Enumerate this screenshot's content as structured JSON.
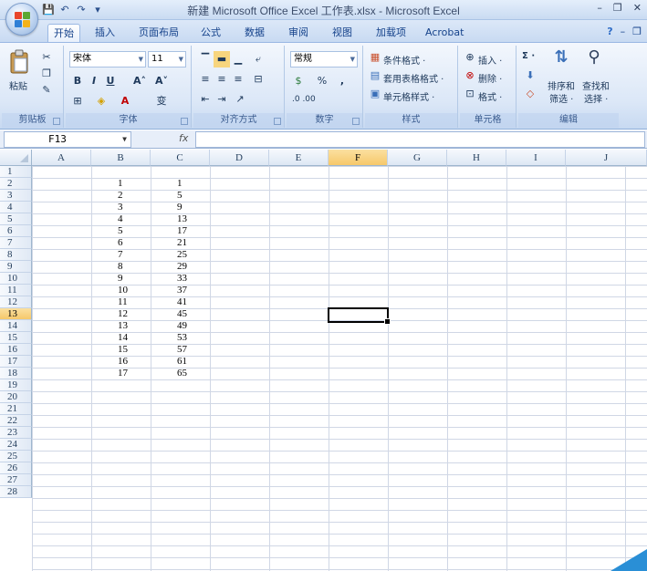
{
  "window": {
    "title": "新建 Microsoft Office Excel 工作表.xlsx - Microsoft Excel",
    "minimize": "–",
    "restore": "❐",
    "close": "✕"
  },
  "qat": {
    "save": "💾",
    "undo": "↶",
    "redo": "↷",
    "more": "▾"
  },
  "tabs": [
    {
      "label": "开始",
      "active": true
    },
    {
      "label": "插入"
    },
    {
      "label": "页面布局"
    },
    {
      "label": "公式"
    },
    {
      "label": "数据"
    },
    {
      "label": "审阅"
    },
    {
      "label": "视图"
    },
    {
      "label": "加载项"
    },
    {
      "label": "Acrobat"
    }
  ],
  "tab_right": {
    "help": "?",
    "min": "–",
    "restore": "❐"
  },
  "ribbon": {
    "clipboard": {
      "label": "剪贴板",
      "paste": "粘贴"
    },
    "font": {
      "label": "字体",
      "name": "宋体",
      "size": "11",
      "bold": "B",
      "italic": "I",
      "underline": "U",
      "grow": "A˄",
      "shrink": "A˅",
      "wen": "变"
    },
    "align": {
      "label": "对齐方式"
    },
    "number": {
      "label": "数字",
      "format": "常规",
      "percent": "%",
      "comma": ",",
      "inc": ".0 .00"
    },
    "styles": {
      "label": "样式",
      "conditional": "条件格式 ·",
      "table": "套用表格格式 ·",
      "cell": "单元格样式 ·"
    },
    "cells": {
      "label": "单元格",
      "insert": "插入 ·",
      "delete": "删除 ·",
      "format": "格式 ·"
    },
    "editing": {
      "label": "编辑",
      "sort": "排序和",
      "filter": "筛选 ·",
      "find": "查找和",
      "select": "选择 ·",
      "sum": "Σ ·"
    }
  },
  "formula_bar": {
    "name_box": "F13",
    "fx": "fx",
    "value": ""
  },
  "grid": {
    "columns": [
      "A",
      "B",
      "C",
      "D",
      "E",
      "F",
      "G",
      "H",
      "I",
      "J"
    ],
    "selected_column": "F",
    "rows": [
      "1",
      "2",
      "3",
      "4",
      "5",
      "6",
      "7",
      "8",
      "9",
      "10",
      "11",
      "12",
      "13",
      "14",
      "15",
      "16",
      "17",
      "18",
      "19",
      "20",
      "21",
      "22",
      "23",
      "24",
      "25",
      "26",
      "27",
      "28"
    ],
    "selected_row": "13",
    "col_b": [
      "",
      "1",
      "2",
      "3",
      "4",
      "5",
      "6",
      "7",
      "8",
      "9",
      "10",
      "11",
      "12",
      "13",
      "14",
      "15",
      "16",
      "17"
    ],
    "col_c": [
      "",
      "1",
      "5",
      "9",
      "13",
      "17",
      "21",
      "25",
      "29",
      "33",
      "37",
      "41",
      "45",
      "49",
      "53",
      "57",
      "61",
      "65"
    ]
  }
}
